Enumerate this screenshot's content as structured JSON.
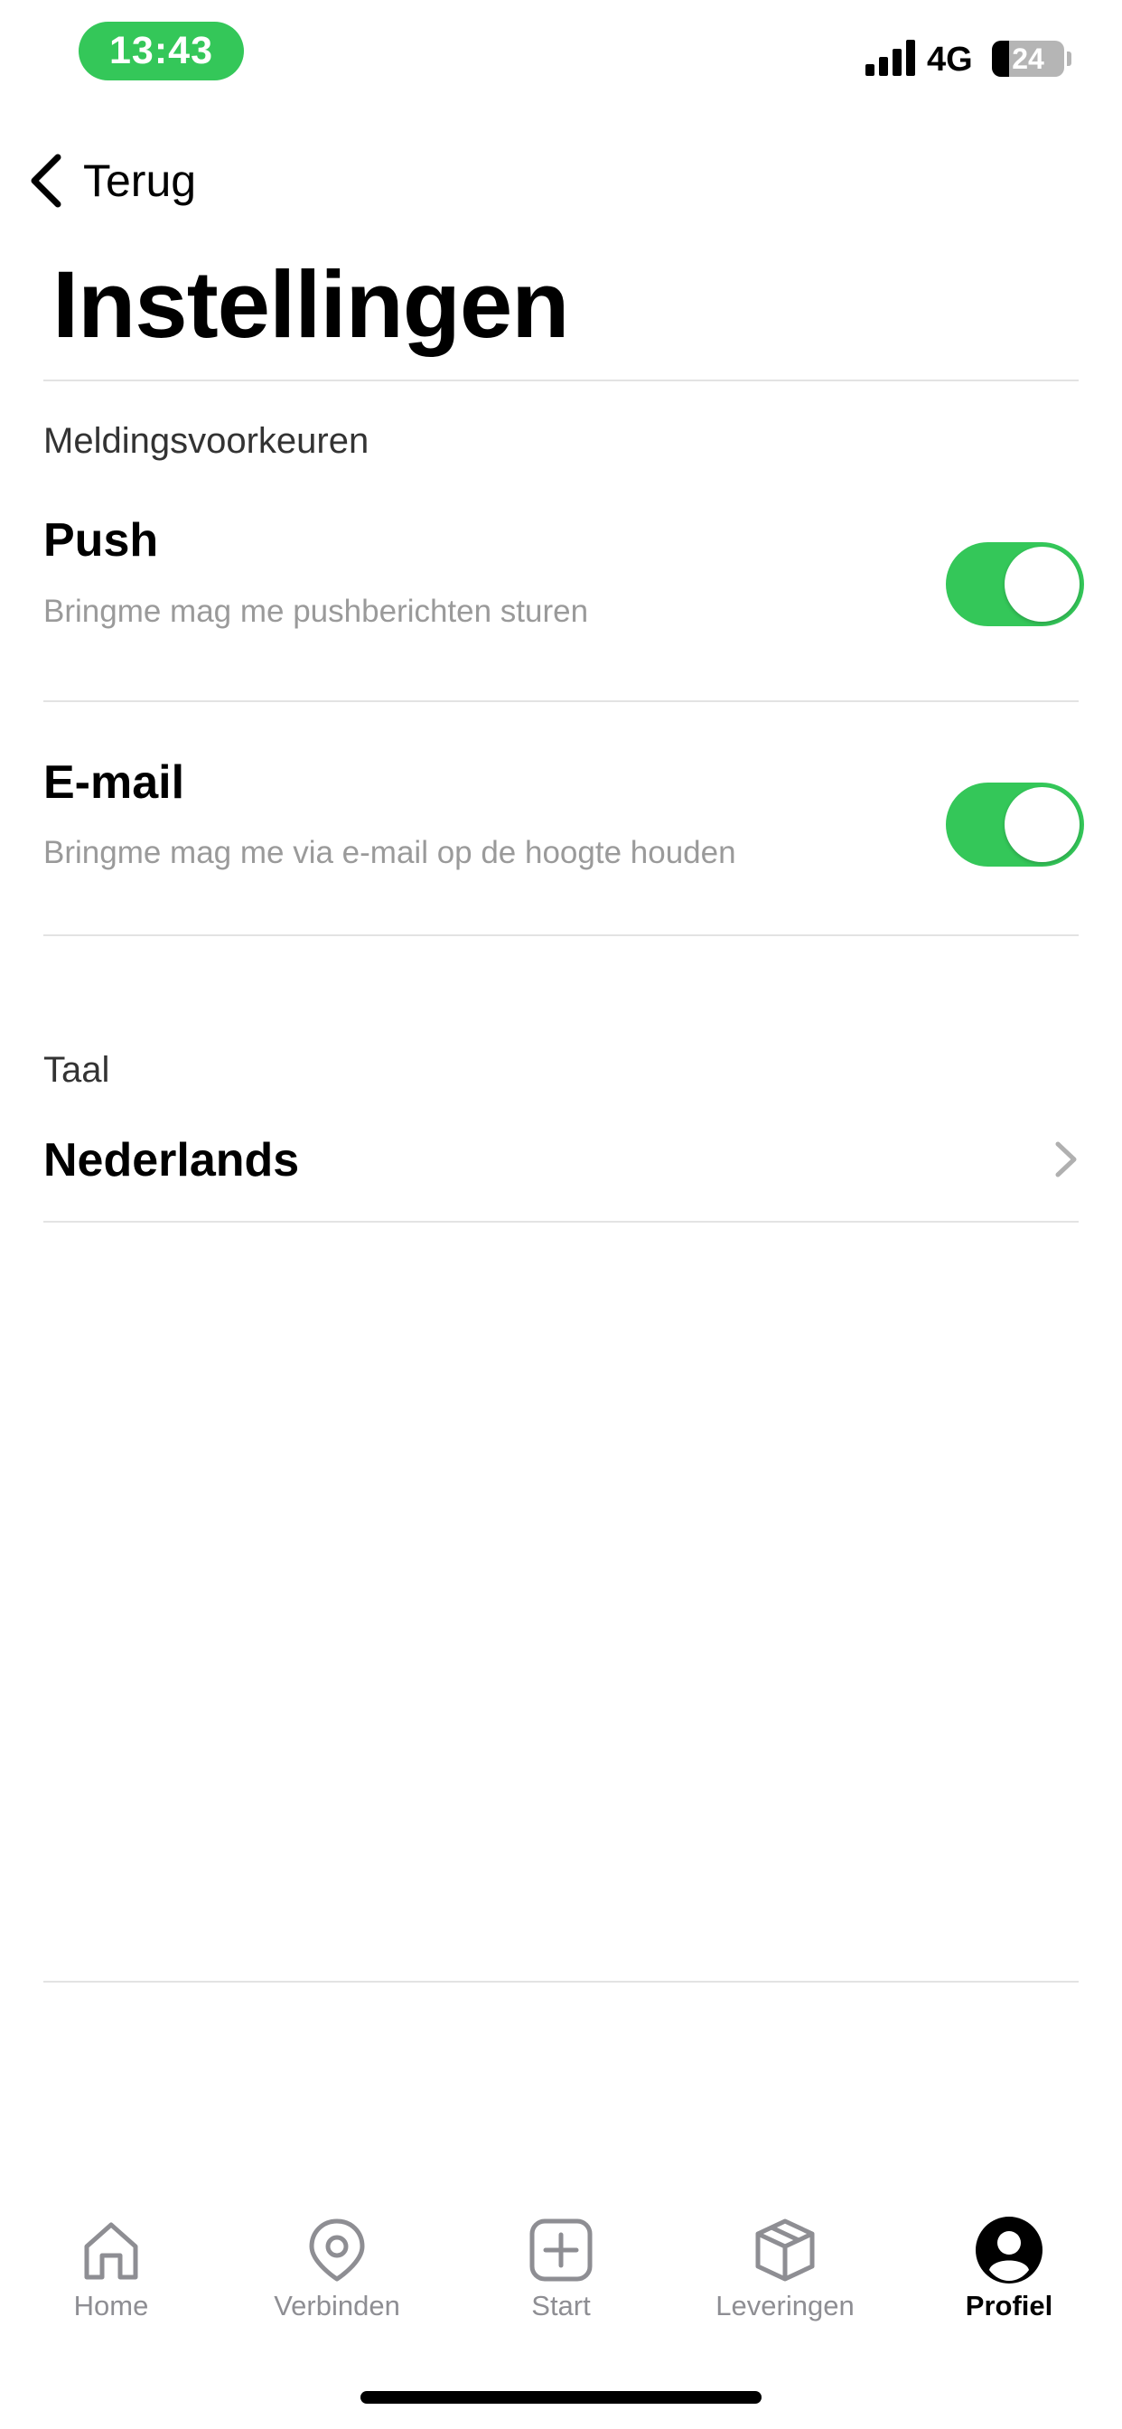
{
  "status_bar": {
    "time": "13:43",
    "network": "4G",
    "battery": "24"
  },
  "header": {
    "back_label": "Terug",
    "title": "Instellingen"
  },
  "notifications": {
    "section_label": "Meldingsvoorkeuren",
    "items": [
      {
        "title": "Push",
        "subtitle": "Bringme mag me pushberichten sturen",
        "enabled": true
      },
      {
        "title": "E-mail",
        "subtitle": "Bringme mag me via e-mail op de hoogte houden",
        "enabled": true
      }
    ]
  },
  "language": {
    "section_label": "Taal",
    "value": "Nederlands"
  },
  "tab_bar": {
    "items": [
      {
        "label": "Home",
        "icon": "home-icon"
      },
      {
        "label": "Verbinden",
        "icon": "location-pin-icon"
      },
      {
        "label": "Start",
        "icon": "plus-square-icon"
      },
      {
        "label": "Leveringen",
        "icon": "package-icon"
      },
      {
        "label": "Profiel",
        "icon": "profile-icon",
        "active": true
      }
    ]
  },
  "colors": {
    "accent_green": "#34c759",
    "divider": "#e3e3e3",
    "inactive_tab": "#8e8e93"
  }
}
